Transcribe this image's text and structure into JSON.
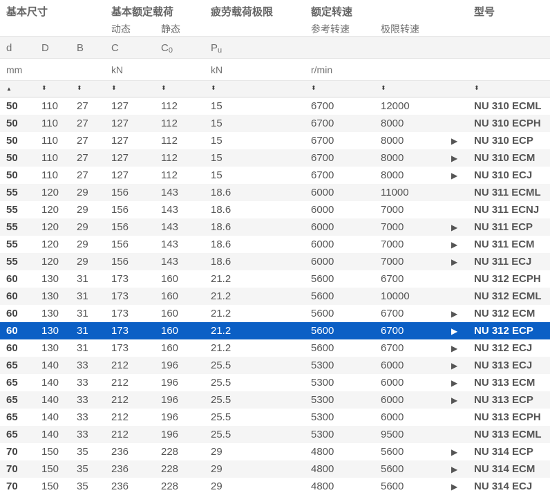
{
  "header": {
    "groups": {
      "dimensions": "基本尺寸",
      "load_ratings": "基本额定载荷",
      "fatigue": "疲劳载荷极限",
      "speeds": "额定转速",
      "designation": "型号"
    },
    "sub": {
      "dynamic": "动态",
      "static": "静态",
      "reference": "参考转速",
      "limiting": "极限转速"
    },
    "symbols": {
      "d": "d",
      "D": "D",
      "B": "B",
      "C": "C",
      "C0": "C",
      "C0_sub": "0",
      "Pu": "P",
      "Pu_sub": "u"
    },
    "units": {
      "mm": "mm",
      "kN1": "kN",
      "kN2": "kN",
      "rpm": "r/min"
    },
    "sort": {
      "asc": "▲",
      "both": "⬍"
    }
  },
  "rows": [
    {
      "d": "50",
      "D": "110",
      "B": "27",
      "C": "127",
      "C0": "112",
      "Pu": "15",
      "ref": "6700",
      "lim": "12000",
      "arrow": "",
      "model": "NU 310 ECML"
    },
    {
      "d": "50",
      "D": "110",
      "B": "27",
      "C": "127",
      "C0": "112",
      "Pu": "15",
      "ref": "6700",
      "lim": "8000",
      "arrow": "",
      "model": "NU 310 ECPH"
    },
    {
      "d": "50",
      "D": "110",
      "B": "27",
      "C": "127",
      "C0": "112",
      "Pu": "15",
      "ref": "6700",
      "lim": "8000",
      "arrow": "▶",
      "model": "NU 310 ECP"
    },
    {
      "d": "50",
      "D": "110",
      "B": "27",
      "C": "127",
      "C0": "112",
      "Pu": "15",
      "ref": "6700",
      "lim": "8000",
      "arrow": "▶",
      "model": "NU 310 ECM"
    },
    {
      "d": "50",
      "D": "110",
      "B": "27",
      "C": "127",
      "C0": "112",
      "Pu": "15",
      "ref": "6700",
      "lim": "8000",
      "arrow": "▶",
      "model": "NU 310 ECJ"
    },
    {
      "d": "55",
      "D": "120",
      "B": "29",
      "C": "156",
      "C0": "143",
      "Pu": "18.6",
      "ref": "6000",
      "lim": "11000",
      "arrow": "",
      "model": "NU 311 ECML"
    },
    {
      "d": "55",
      "D": "120",
      "B": "29",
      "C": "156",
      "C0": "143",
      "Pu": "18.6",
      "ref": "6000",
      "lim": "7000",
      "arrow": "",
      "model": "NU 311 ECNJ"
    },
    {
      "d": "55",
      "D": "120",
      "B": "29",
      "C": "156",
      "C0": "143",
      "Pu": "18.6",
      "ref": "6000",
      "lim": "7000",
      "arrow": "▶",
      "model": "NU 311 ECP"
    },
    {
      "d": "55",
      "D": "120",
      "B": "29",
      "C": "156",
      "C0": "143",
      "Pu": "18.6",
      "ref": "6000",
      "lim": "7000",
      "arrow": "▶",
      "model": "NU 311 ECM"
    },
    {
      "d": "55",
      "D": "120",
      "B": "29",
      "C": "156",
      "C0": "143",
      "Pu": "18.6",
      "ref": "6000",
      "lim": "7000",
      "arrow": "▶",
      "model": "NU 311 ECJ"
    },
    {
      "d": "60",
      "D": "130",
      "B": "31",
      "C": "173",
      "C0": "160",
      "Pu": "21.2",
      "ref": "5600",
      "lim": "6700",
      "arrow": "",
      "model": "NU 312 ECPH"
    },
    {
      "d": "60",
      "D": "130",
      "B": "31",
      "C": "173",
      "C0": "160",
      "Pu": "21.2",
      "ref": "5600",
      "lim": "10000",
      "arrow": "",
      "model": "NU 312 ECML"
    },
    {
      "d": "60",
      "D": "130",
      "B": "31",
      "C": "173",
      "C0": "160",
      "Pu": "21.2",
      "ref": "5600",
      "lim": "6700",
      "arrow": "▶",
      "model": "NU 312 ECM"
    },
    {
      "d": "60",
      "D": "130",
      "B": "31",
      "C": "173",
      "C0": "160",
      "Pu": "21.2",
      "ref": "5600",
      "lim": "6700",
      "arrow": "▶",
      "model": "NU 312 ECP",
      "selected": true
    },
    {
      "d": "60",
      "D": "130",
      "B": "31",
      "C": "173",
      "C0": "160",
      "Pu": "21.2",
      "ref": "5600",
      "lim": "6700",
      "arrow": "▶",
      "model": "NU 312 ECJ"
    },
    {
      "d": "65",
      "D": "140",
      "B": "33",
      "C": "212",
      "C0": "196",
      "Pu": "25.5",
      "ref": "5300",
      "lim": "6000",
      "arrow": "▶",
      "model": "NU 313 ECJ"
    },
    {
      "d": "65",
      "D": "140",
      "B": "33",
      "C": "212",
      "C0": "196",
      "Pu": "25.5",
      "ref": "5300",
      "lim": "6000",
      "arrow": "▶",
      "model": "NU 313 ECM"
    },
    {
      "d": "65",
      "D": "140",
      "B": "33",
      "C": "212",
      "C0": "196",
      "Pu": "25.5",
      "ref": "5300",
      "lim": "6000",
      "arrow": "▶",
      "model": "NU 313 ECP"
    },
    {
      "d": "65",
      "D": "140",
      "B": "33",
      "C": "212",
      "C0": "196",
      "Pu": "25.5",
      "ref": "5300",
      "lim": "6000",
      "arrow": "",
      "model": "NU 313 ECPH"
    },
    {
      "d": "65",
      "D": "140",
      "B": "33",
      "C": "212",
      "C0": "196",
      "Pu": "25.5",
      "ref": "5300",
      "lim": "9500",
      "arrow": "",
      "model": "NU 313 ECML"
    },
    {
      "d": "70",
      "D": "150",
      "B": "35",
      "C": "236",
      "C0": "228",
      "Pu": "29",
      "ref": "4800",
      "lim": "5600",
      "arrow": "▶",
      "model": "NU 314 ECP"
    },
    {
      "d": "70",
      "D": "150",
      "B": "35",
      "C": "236",
      "C0": "228",
      "Pu": "29",
      "ref": "4800",
      "lim": "5600",
      "arrow": "▶",
      "model": "NU 314 ECM"
    },
    {
      "d": "70",
      "D": "150",
      "B": "35",
      "C": "236",
      "C0": "228",
      "Pu": "29",
      "ref": "4800",
      "lim": "5600",
      "arrow": "▶",
      "model": "NU 314 ECJ"
    }
  ]
}
